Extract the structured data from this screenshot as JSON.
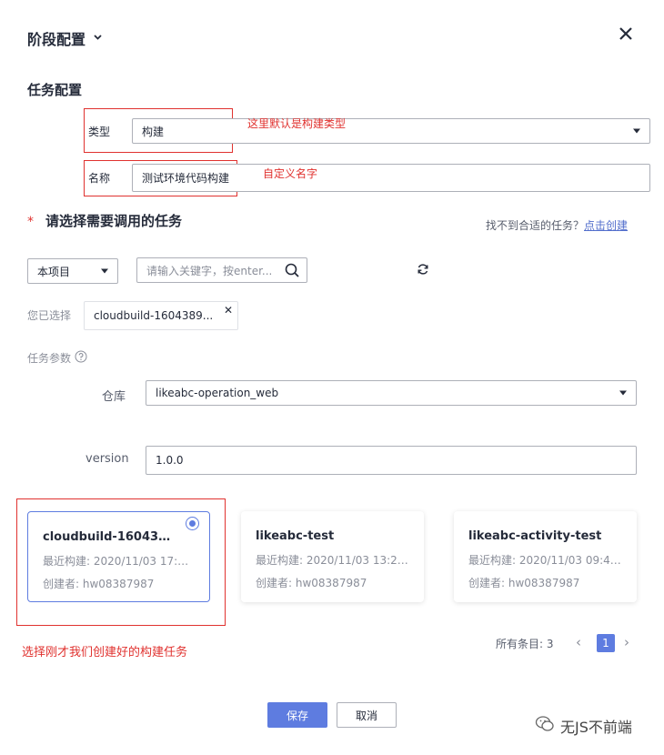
{
  "header": {
    "title": "阶段配置",
    "close_icon": "close-icon"
  },
  "task_config": {
    "section_title": "任务配置",
    "type_label": "类型",
    "type_value": "构建",
    "type_note": "这里默认是构建类型",
    "name_label": "名称",
    "name_value": "测试环境代码构建",
    "name_note": "自定义名字"
  },
  "choose_task": {
    "required_mark": "*",
    "title": "请选择需要调用的任务",
    "hint_text": "找不到合适的任务？",
    "hint_link": "点击创建"
  },
  "filters": {
    "scope_value": "本项目",
    "search_placeholder": "请输入关键字，按enter...",
    "refresh_icon": "refresh-icon"
  },
  "selected": {
    "label": "您已选择",
    "chip_text": "cloudbuild-1604389...",
    "remove_icon": "close-icon"
  },
  "params": {
    "label": "任务参数",
    "help_icon": "question-icon",
    "repo_label": "仓库",
    "repo_value": "likeabc-operation_web",
    "version_label": "version",
    "version_value": "1.0.0"
  },
  "cards": [
    {
      "name": "cloudbuild-1604389...",
      "last_build": "最近构建: 2020/11/03 17:13:0...",
      "creator": "创建者: hw08387987",
      "selected": true
    },
    {
      "name": "likeabc-test",
      "last_build": "最近构建: 2020/11/03 13:29:...",
      "creator": "创建者: hw08387987",
      "selected": false
    },
    {
      "name": "likeabc-activity-test",
      "last_build": "最近构建: 2020/11/03 09:44:...",
      "creator": "创建者: hw08387987",
      "selected": false
    }
  ],
  "card_note": "选择刚才我们创建好的构建任务",
  "pagination": {
    "total_label": "所有条目: 3",
    "current_page": "1",
    "prev": "‹",
    "next": "›"
  },
  "footer": {
    "save_label": "保存",
    "cancel_label": "取消"
  },
  "watermark": {
    "text": "无JS不前端"
  },
  "colors": {
    "accent": "#5e7ce0",
    "annotation_red": "#e0322f"
  }
}
